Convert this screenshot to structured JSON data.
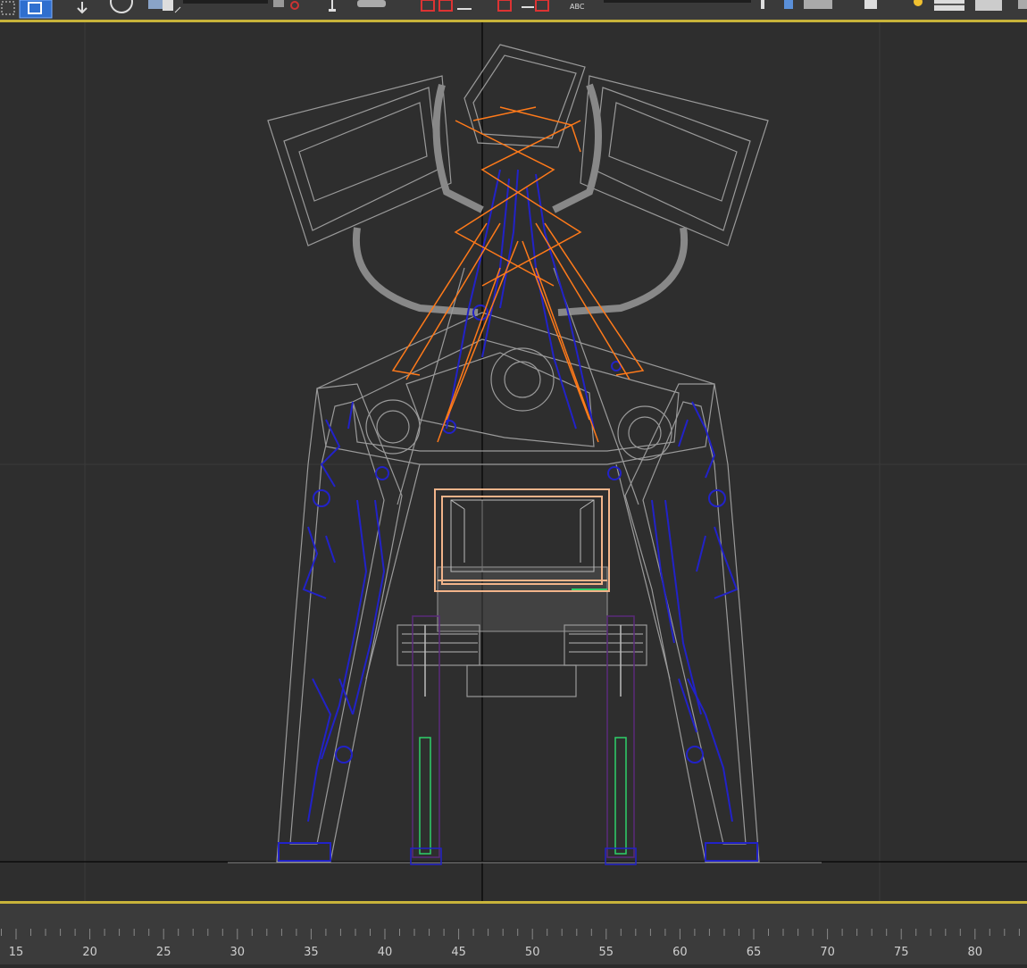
{
  "toolbar": {
    "icons": [
      "select-region-icon",
      "select-object-icon",
      "move-icon",
      "rotate-icon",
      "scale-icon",
      "snap-toggle-icon",
      "transform-icon",
      "render-setup-icon",
      "mirror-icon",
      "align-icon",
      "layer-icon",
      "spell-icon",
      "named-selection-icon",
      "material-editor-icon",
      "render-icon",
      "light-icon",
      "scene-explorer-icon",
      "layer-explorer-icon"
    ],
    "spell_label": "ABC"
  },
  "viewport": {
    "colors": {
      "background": "#2e2e2e",
      "grid": "#3a3a3a",
      "axis": "#0c0c0c",
      "frame": "#9a9a9a",
      "circuit": "#2222c8",
      "orange": "#ff7a1a",
      "peach": "#f2b48a",
      "purple": "#5a2a7a",
      "green": "#2ed06a",
      "border": "#c8b33a"
    }
  },
  "timeline": {
    "ticks": [
      "15",
      "20",
      "25",
      "30",
      "35",
      "40",
      "45",
      "50",
      "55",
      "60",
      "65",
      "70",
      "75",
      "80"
    ]
  }
}
